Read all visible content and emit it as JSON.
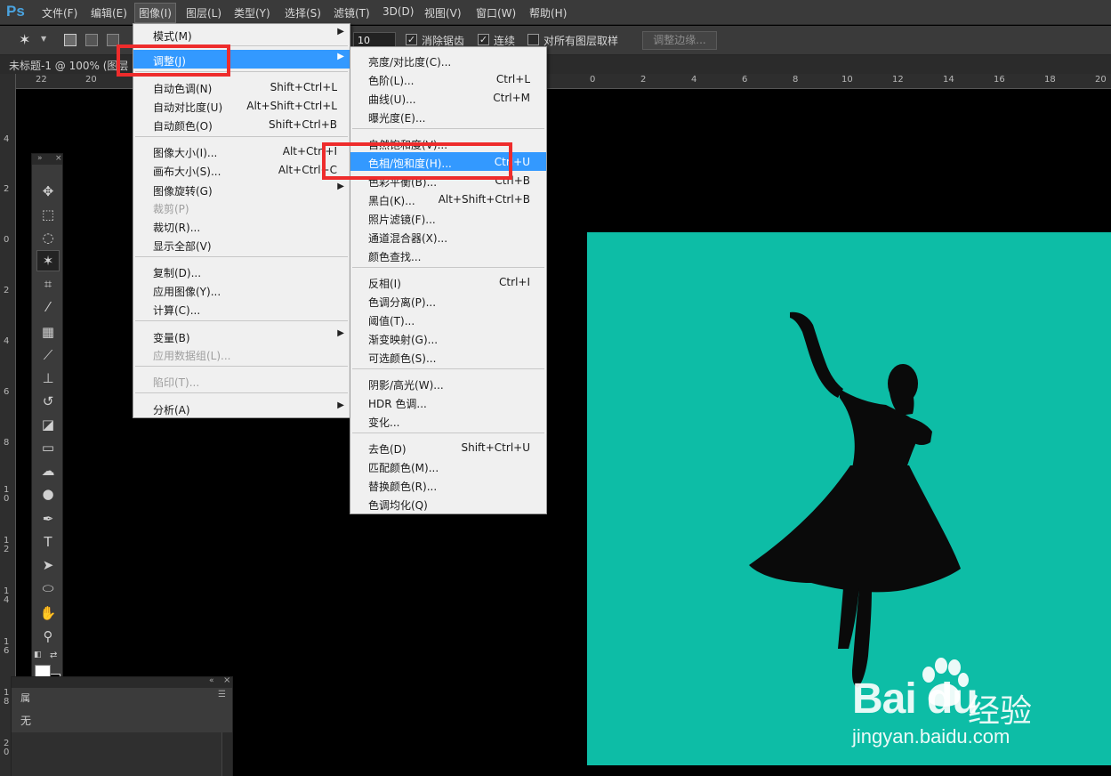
{
  "app": {
    "logo": "Ps"
  },
  "menubar": {
    "items": [
      "文件(F)",
      "编辑(E)",
      "图像(I)",
      "图层(L)",
      "类型(Y)",
      "选择(S)",
      "滤镜(T)",
      "3D(D)",
      "视图(V)",
      "窗口(W)",
      "帮助(H)"
    ],
    "active": "图像(I)"
  },
  "options": {
    "tolerance_value": "10",
    "antialias_label": "消除锯齿",
    "antialias_checked": true,
    "contiguous_label": "连续",
    "contiguous_checked": true,
    "sample_all_label": "对所有图层取样",
    "sample_all_checked": false,
    "refine_edge_label": "调整边缘..."
  },
  "document": {
    "tab_title": "未标题-1 @ 100% (图层 1"
  },
  "rulers": {
    "top": [
      "22",
      "20",
      "0",
      "2",
      "4",
      "6",
      "8",
      "10",
      "12",
      "14",
      "16",
      "18",
      "20"
    ],
    "left": [
      "4",
      "2",
      "0",
      "2",
      "4",
      "6",
      "8",
      "1 0",
      "1 2",
      "1 4",
      "1 6",
      "1 8",
      "2 0"
    ]
  },
  "image_menu": {
    "items": [
      {
        "label": "模式(M)",
        "submenu": true
      },
      {
        "label": "调整(J)",
        "submenu": true,
        "highlighted": true
      },
      {
        "label": "自动色调(N)",
        "shortcut": "Shift+Ctrl+L"
      },
      {
        "label": "自动对比度(U)",
        "shortcut": "Alt+Shift+Ctrl+L"
      },
      {
        "label": "自动颜色(O)",
        "shortcut": "Shift+Ctrl+B"
      },
      {
        "label": "图像大小(I)...",
        "shortcut": "Alt+Ctrl+I"
      },
      {
        "label": "画布大小(S)...",
        "shortcut": "Alt+Ctrl+C"
      },
      {
        "label": "图像旋转(G)",
        "submenu": true
      },
      {
        "label": "裁剪(P)",
        "disabled": true
      },
      {
        "label": "裁切(R)..."
      },
      {
        "label": "显示全部(V)"
      },
      {
        "label": "复制(D)..."
      },
      {
        "label": "应用图像(Y)..."
      },
      {
        "label": "计算(C)..."
      },
      {
        "label": "变量(B)",
        "submenu": true
      },
      {
        "label": "应用数据组(L)...",
        "disabled": true
      },
      {
        "label": "陷印(T)...",
        "disabled": true
      },
      {
        "label": "分析(A)",
        "submenu": true
      }
    ]
  },
  "adjust_menu": {
    "items": [
      {
        "label": "亮度/对比度(C)..."
      },
      {
        "label": "色阶(L)...",
        "shortcut": "Ctrl+L"
      },
      {
        "label": "曲线(U)...",
        "shortcut": "Ctrl+M"
      },
      {
        "label": "曝光度(E)..."
      },
      {
        "label": "自然饱和度(V)..."
      },
      {
        "label": "色相/饱和度(H)...",
        "shortcut": "Ctrl+U",
        "highlighted": true
      },
      {
        "label": "色彩平衡(B)...",
        "shortcut": "Ctrl+B"
      },
      {
        "label": "黑白(K)...",
        "shortcut": "Alt+Shift+Ctrl+B"
      },
      {
        "label": "照片滤镜(F)..."
      },
      {
        "label": "通道混合器(X)..."
      },
      {
        "label": "颜色查找..."
      },
      {
        "label": "反相(I)",
        "shortcut": "Ctrl+I"
      },
      {
        "label": "色调分离(P)..."
      },
      {
        "label": "阈值(T)..."
      },
      {
        "label": "渐变映射(G)..."
      },
      {
        "label": "可选颜色(S)..."
      },
      {
        "label": "阴影/高光(W)..."
      },
      {
        "label": "HDR 色调..."
      },
      {
        "label": "变化..."
      },
      {
        "label": "去色(D)",
        "shortcut": "Shift+Ctrl+U"
      },
      {
        "label": "匹配颜色(M)..."
      },
      {
        "label": "替换颜色(R)..."
      },
      {
        "label": "色调均化(Q)"
      }
    ]
  },
  "panel": {
    "tab_label": "属",
    "none_label": "无"
  },
  "watermark": {
    "logo": "Bai du",
    "text": "经验",
    "url": "jingyan.baidu.com"
  },
  "colors": {
    "canvas_bg": "#0dbda6",
    "menu_highlight": "#3399ff",
    "annotation_red": "#ee2c2c",
    "workspace": "#000000",
    "chrome": "#3a3a3a"
  }
}
